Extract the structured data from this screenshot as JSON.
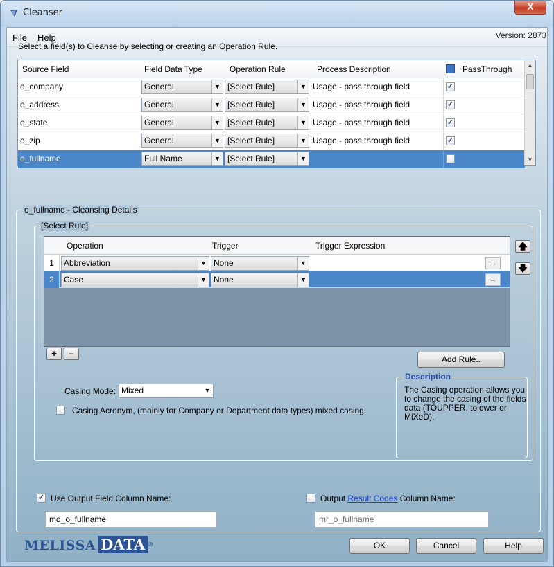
{
  "window": {
    "title": "Cleanser",
    "close_label": "X"
  },
  "menu": {
    "file": "File",
    "help": "Help"
  },
  "version": "Version: 2873",
  "instruction": "Select a field(s) to Cleanse by selecting or creating an Operation Rule.",
  "source_grid": {
    "columns": {
      "source": "Source Field",
      "type": "Field Data Type",
      "rule": "Operation Rule",
      "desc": "Process Description",
      "pass": "PassThrough"
    },
    "rows": [
      {
        "source": "o_company",
        "type": "General",
        "rule": "[Select Rule]",
        "desc": "Usage - pass through field",
        "pass": true
      },
      {
        "source": "o_address",
        "type": "General",
        "rule": "[Select Rule]",
        "desc": "Usage - pass through field",
        "pass": true
      },
      {
        "source": "o_state",
        "type": "General",
        "rule": "[Select Rule]",
        "desc": "Usage - pass through field",
        "pass": true
      },
      {
        "source": "o_zip",
        "type": "General",
        "rule": "[Select Rule]",
        "desc": "Usage - pass through field",
        "pass": true
      },
      {
        "source": "o_fullname",
        "type": "Full Name",
        "rule": "[Select Rule]",
        "desc": "",
        "pass": false,
        "selected": true
      }
    ]
  },
  "details": {
    "group_title": "o_fullname - Cleansing Details",
    "rule_group_title": "[Select Rule]",
    "op_grid": {
      "columns": {
        "operation": "Operation",
        "trigger": "Trigger",
        "expression": "Trigger Expression"
      },
      "rows": [
        {
          "num": "1",
          "operation": "Abbreviation",
          "trigger": "None",
          "expression": ""
        },
        {
          "num": "2",
          "operation": "Case",
          "trigger": "None",
          "expression": "",
          "selected": true
        }
      ]
    },
    "add_label": "+",
    "remove_label": "–",
    "add_rule": "Add Rule..",
    "casing_mode_label": "Casing Mode:",
    "casing_mode_value": "Mixed",
    "casing_acronym": "Casing Acronym, (mainly for Company or Department data types) mixed casing.",
    "description_title": "Description",
    "description_text": "The Casing operation allows you to change the casing of the fields data (TOUPPER, tolower or MiXeD)."
  },
  "output": {
    "use_output_label": "Use Output Field Column Name:",
    "use_output_checked": true,
    "output_value": "md_o_fullname",
    "result_prefix": "Output ",
    "result_link": "Result Codes",
    "result_suffix": " Column Name:",
    "result_checked": false,
    "result_value": "mr_o_fullname"
  },
  "footer": {
    "logo_a": "MELISSA",
    "logo_b": "DATA",
    "logo_mark": "®",
    "ok": "OK",
    "cancel": "Cancel",
    "help": "Help"
  },
  "colors": {
    "selection": "#4a86c8",
    "logo": "#2b5395",
    "link": "#1a3fd0"
  },
  "icons": {
    "app": "app-icon",
    "up": "move-up-icon",
    "down": "move-down-icon"
  }
}
